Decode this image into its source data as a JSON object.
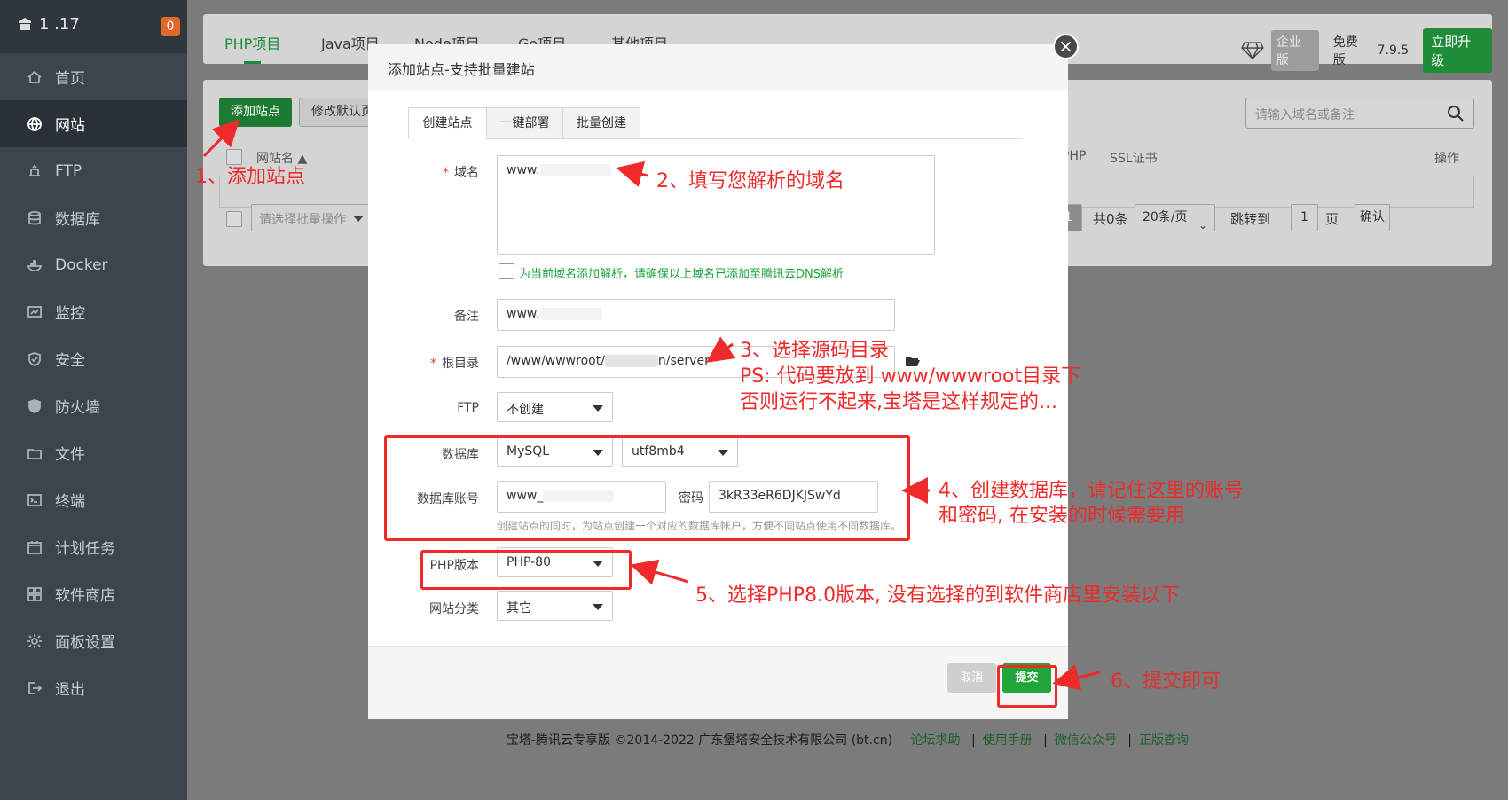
{
  "sidebar": {
    "host": "1 .17",
    "badge": "0",
    "items": [
      {
        "label": "首页",
        "icon": "home-icon"
      },
      {
        "label": "网站",
        "icon": "globe-icon"
      },
      {
        "label": "FTP",
        "icon": "ftp-icon"
      },
      {
        "label": "数据库",
        "icon": "database-icon"
      },
      {
        "label": "Docker",
        "icon": "docker-icon"
      },
      {
        "label": "监控",
        "icon": "monitor-icon"
      },
      {
        "label": "安全",
        "icon": "shield-icon"
      },
      {
        "label": "防火墙",
        "icon": "firewall-icon"
      },
      {
        "label": "文件",
        "icon": "folder-icon"
      },
      {
        "label": "终端",
        "icon": "terminal-icon"
      },
      {
        "label": "计划任务",
        "icon": "calendar-icon"
      },
      {
        "label": "软件商店",
        "icon": "grid-icon"
      },
      {
        "label": "面板设置",
        "icon": "gear-icon"
      },
      {
        "label": "退出",
        "icon": "logout-icon"
      }
    ]
  },
  "topbar": {
    "tabs": [
      "PHP项目",
      "Java项目",
      "Node项目",
      "Go项目",
      "其他项目"
    ],
    "enterprise_label": "企业版",
    "free_label": "免费版",
    "version": "7.9.5",
    "upgrade_label": "立即升级"
  },
  "site_list": {
    "add_button": "添加站点",
    "default_page_button": "修改默认页",
    "search_placeholder": "请输入域名或备注",
    "headers": [
      "网站名 ▲",
      "PHP",
      "SSL证书",
      "操作"
    ],
    "batch_placeholder": "请选择批量操作",
    "page_current": "1",
    "total": "共0条",
    "per_page": "20条/页",
    "jump_label": "跳转到",
    "jump_value": "1",
    "page_unit": "页",
    "confirm_label": "确认"
  },
  "modal": {
    "title": "添加站点-支持批量建站",
    "tabs": [
      "创建站点",
      "一键部署",
      "批量创建"
    ],
    "domain_label": "域名",
    "domain_value": "www.",
    "dns_hint": "为当前域名添加解析，请确保以上域名已添加至腾讯云DNS解析",
    "remark_label": "备注",
    "remark_value": "www.",
    "root_label": "根目录",
    "root_value_a": "/www/wwwroot/",
    "root_value_b": "n/server",
    "ftp_label": "FTP",
    "ftp_value": "不创建",
    "db_label": "数据库",
    "db_value": "MySQL",
    "db_charset": "utf8mb4",
    "db_account_label": "数据库账号",
    "db_account_value": "www_",
    "password_label": "密码",
    "password_value": "3kR33eR6DJKJSwYd",
    "db_hint": "创建站点的同时，为站点创建一个对应的数据库帐户，方便不同站点使用不同数据库。",
    "php_label": "PHP版本",
    "php_value": "PHP-80",
    "category_label": "网站分类",
    "category_value": "其它",
    "cancel_label": "取消",
    "submit_label": "提交"
  },
  "annotations": {
    "step1": "1、添加站点",
    "step2": "2、填写您解析的域名",
    "step3_line1": "3、选择源码目录",
    "step3_line2": "PS: 代码要放到 www/wwwroot目录下",
    "step3_line3": "否则运行不起来,宝塔是这样规定的...",
    "step4_line1": "4、创建数据库，请记住这里的账号",
    "step4_line2": "和密码, 在安装的时候需要用",
    "step5": "5、选择PHP8.0版本, 没有选择的到软件商店里安装以下",
    "step6": "6、提交即可"
  },
  "footer": {
    "copyright": "宝塔-腾讯云专享版 ©2014-2022 广东堡塔安全技术有限公司 (bt.cn)",
    "links": [
      "论坛求助",
      "使用手册",
      "微信公众号",
      "正版查询"
    ]
  },
  "colors": {
    "accent_green": "#20a53a",
    "annotation_red": "#ee2a2a",
    "sidebar_bg": "#3c444d"
  }
}
